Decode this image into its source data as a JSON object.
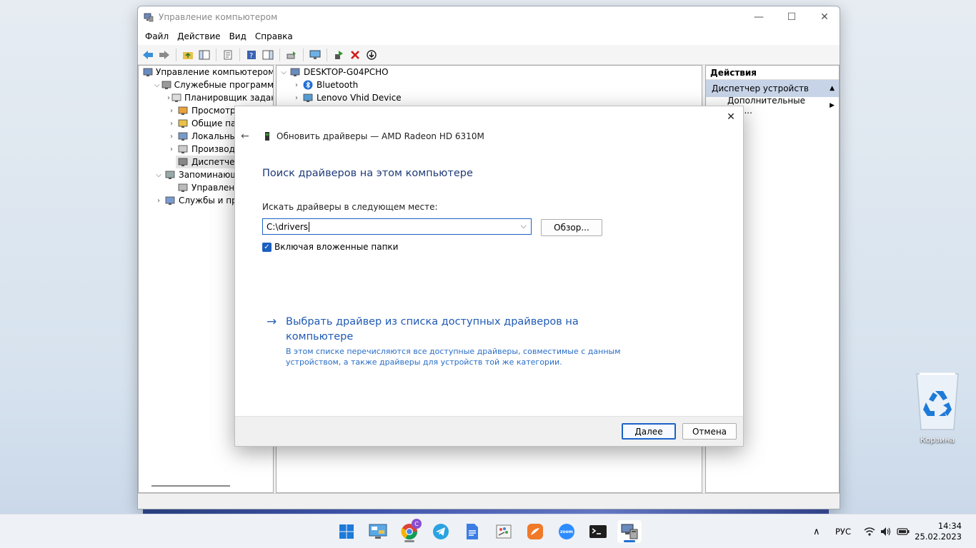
{
  "window": {
    "title": "Управление компьютером",
    "minimize": "—",
    "maximize": "☐",
    "close": "✕"
  },
  "menu": [
    "Файл",
    "Действие",
    "Вид",
    "Справка"
  ],
  "left_tree": [
    {
      "label": "Управление компьютером (л",
      "chev": "",
      "indent": 0
    },
    {
      "label": "Служебные программы",
      "chev": "⌵",
      "indent": 1
    },
    {
      "label": "Планировщик заданий",
      "chev": "›",
      "indent": 2
    },
    {
      "label": "Просмотр со",
      "chev": "›",
      "indent": 2
    },
    {
      "label": "Общие папки",
      "chev": "›",
      "indent": 2
    },
    {
      "label": "Локальные п",
      "chev": "›",
      "indent": 2
    },
    {
      "label": "Производите",
      "chev": "›",
      "indent": 2
    },
    {
      "label": "Диспетчер ус",
      "chev": "",
      "indent": 2
    },
    {
      "label": "Запоминающие",
      "chev": "⌵",
      "indent": 1
    },
    {
      "label": "Управление д",
      "chev": "",
      "indent": 2
    },
    {
      "label": "Службы и прило",
      "chev": "›",
      "indent": 1
    }
  ],
  "mid_tree": [
    {
      "label": "DESKTOP-G04PCHO",
      "chev": "⌵",
      "indent": 0
    },
    {
      "label": "Bluetooth",
      "chev": "›",
      "indent": 1
    },
    {
      "label": "Lenovo Vhid Device",
      "chev": "›",
      "indent": 1
    }
  ],
  "actions": {
    "header": "Действия",
    "selected": "Диспетчер устройств",
    "selected_arrow": "▲",
    "more": "Дополнительные дей...",
    "more_arrow": "▶"
  },
  "dialog": {
    "close": "✕",
    "back": "←",
    "title": "Обновить драйверы — AMD Radeon HD 6310M",
    "heading": "Поиск драйверов на этом компьютере",
    "label": "Искать драйверы в следующем месте:",
    "path_value": "C:\\drivers",
    "caret": "⌵",
    "browse": "Обзор...",
    "checkbox_checked": "✓",
    "checkbox_label": "Включая вложенные папки",
    "link_arrow": "→",
    "link_title": "Выбрать драйвер из списка доступных драйверов на компьютере",
    "link_desc": "В этом списке перечисляются все доступные драйверы, совместимые с данным устройством, а также драйверы для устройств той же категории.",
    "next": "Далее",
    "cancel": "Отмена"
  },
  "desktop": {
    "recycle_bin": "Корзина"
  },
  "taskbar": {
    "apps": [
      "windows-start",
      "control-panel",
      "chrome",
      "telegram",
      "google-docs",
      "paint",
      "app-orange",
      "zoom",
      "terminal",
      "computer-management"
    ],
    "chrome_badge": "C",
    "zoom_text": "zoom",
    "tray_chevron": "∧",
    "lang": "РУС",
    "time": "14:34",
    "date": "25.02.2023"
  }
}
